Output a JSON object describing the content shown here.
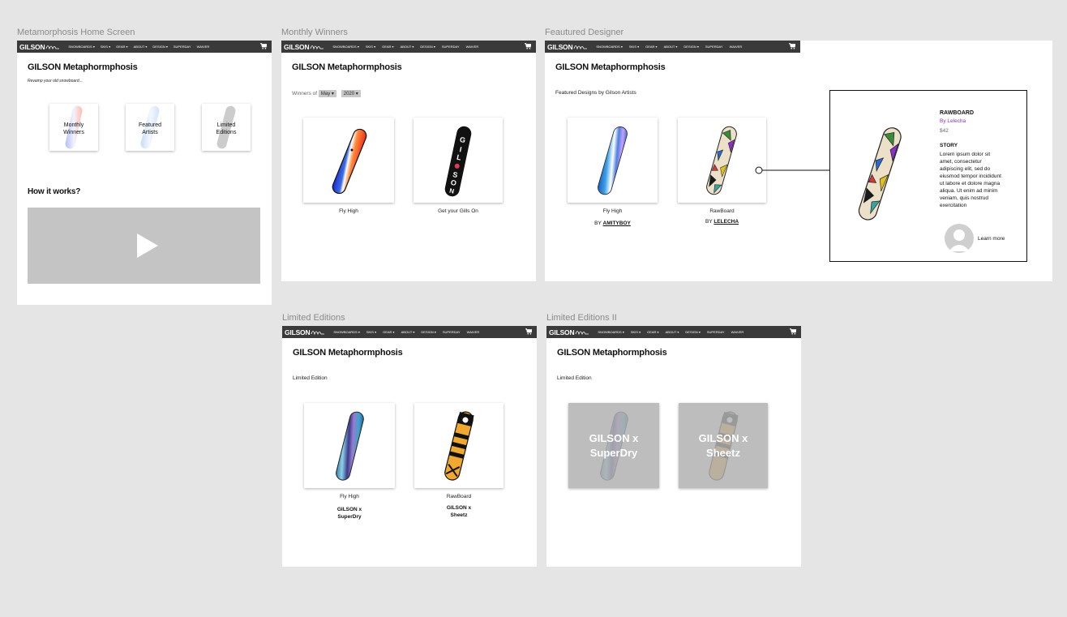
{
  "brand": {
    "logo_text": "GILSON"
  },
  "nav_items": [
    "SNOWBOARDS ▾",
    "SKIS ▾",
    "GEAR ▾",
    "ABOUT ▾",
    "DESIGN ▾",
    "SUPERDAY",
    "WAIVER"
  ],
  "nav_items_home": [
    "SNOWBOARDS ▾",
    "SKIS ▾",
    "GEAR ▾",
    "ABOUT ▾",
    "DESIGN ▾",
    "SUPERDAY",
    "WAIVER"
  ],
  "site_title": "GILSON Metaphormphosis",
  "frames": {
    "home": {
      "label": "Metamorphosis Home Screen",
      "tagline": "Revamp your old snowboard...",
      "tiles": [
        {
          "label": "Monthly\nWinners"
        },
        {
          "label": "Featured\nArtists"
        },
        {
          "label": "Limited\nEditions"
        }
      ],
      "how_title": "How it works?",
      "video_icon": "play-icon"
    },
    "monthly": {
      "label": "Monthly Winners",
      "filter_label": "Winners of",
      "month": "May",
      "year": "2020",
      "boards": [
        {
          "name": "Fly High"
        },
        {
          "name": "Get your Gills On"
        }
      ]
    },
    "featured": {
      "label": "Feautured Designer",
      "subtitle": "Featured Designs by Gilson Artists",
      "boards": [
        {
          "name": "Fly High",
          "by": "BY",
          "artist": "AMITYBOY"
        },
        {
          "name": "RawBoard",
          "by": "BY",
          "artist": "LELECHA"
        }
      ],
      "detail": {
        "title": "RAWBOARD",
        "by": "By Lelecha",
        "price": "$42",
        "story_title": "STORY",
        "story": "Lorem ipsum dolor sit amet, consectetur adipiscing elit, sed do eiusmod tempor incididunt ut labore et dolore magna aliqua. Ut enim ad minim veniam, quis nostrud exercitation",
        "learn_more": "Learn more"
      }
    },
    "limited": {
      "label": "Limited Editions",
      "subtitle": "Limited Edition",
      "boards": [
        {
          "name": "Fly High",
          "collab": "GILSON x\nSuperDry"
        },
        {
          "name": "RawBoard",
          "collab": "GILSON x\nSheetz"
        }
      ]
    },
    "limited2": {
      "label": "Limited Editions II",
      "subtitle": "Limited Edition",
      "boards": [
        {
          "overlay": "GILSON x\nSuperDry"
        },
        {
          "overlay": "GILSON x\nSheetz"
        }
      ]
    }
  },
  "colors": {
    "nav": "#3a3a3a",
    "artist_link": "#8b2fc9",
    "video": "#c4c4c4"
  }
}
